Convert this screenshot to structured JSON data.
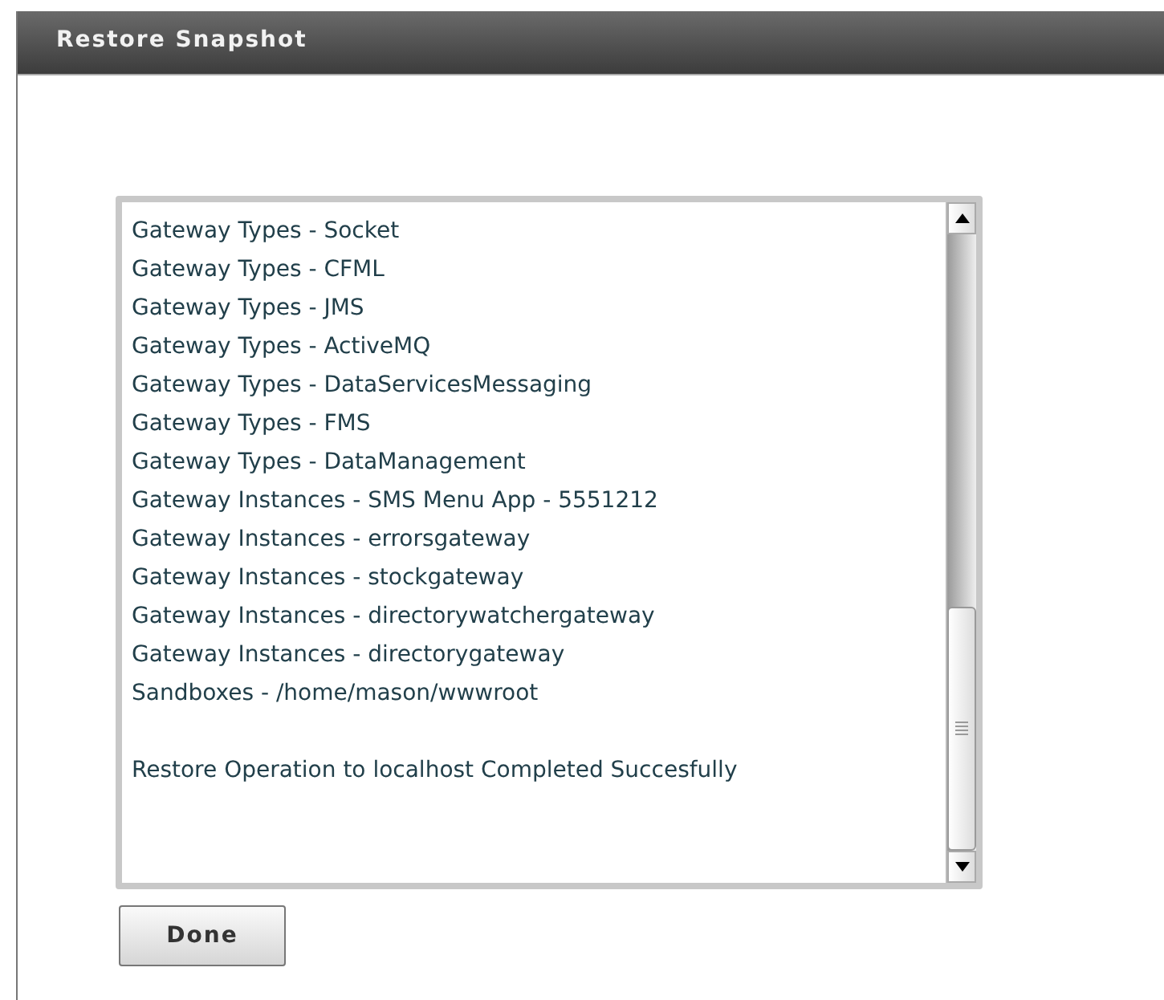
{
  "window": {
    "title": "Restore Snapshot"
  },
  "log": {
    "lines": [
      "Gateway Types - Socket",
      "Gateway Types - CFML",
      "Gateway Types - JMS",
      "Gateway Types - ActiveMQ",
      "Gateway Types - DataServicesMessaging",
      "Gateway Types - FMS",
      "Gateway Types - DataManagement",
      "Gateway Instances - SMS Menu App - 5551212",
      "Gateway Instances - errorsgateway",
      "Gateway Instances - stockgateway",
      "Gateway Instances - directorywatchergateway",
      "Gateway Instances - directorygateway",
      "Sandboxes - /home/mason/wwwroot"
    ],
    "message": "Restore Operation to localhost Completed Succesfully"
  },
  "buttons": [
    {
      "label": "Done"
    }
  ]
}
